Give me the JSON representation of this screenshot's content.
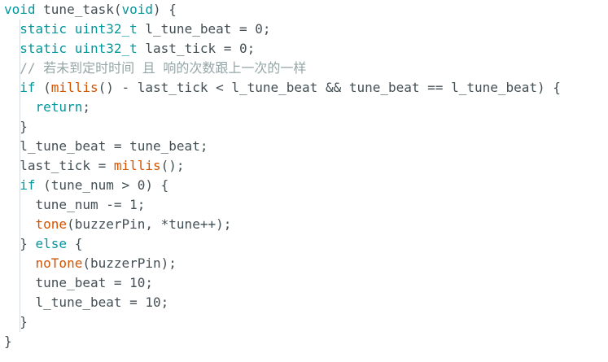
{
  "editor": {
    "lines": [
      {
        "indent": "",
        "tokens": [
          {
            "t": "void",
            "c": "kw"
          },
          {
            "t": " tune_task(",
            "c": "tx"
          },
          {
            "t": "void",
            "c": "kw"
          },
          {
            "t": ") {",
            "c": "tx"
          }
        ]
      },
      {
        "indent": "  ",
        "tokens": [
          {
            "t": "static",
            "c": "kw"
          },
          {
            "t": " ",
            "c": "tx"
          },
          {
            "t": "uint32_t",
            "c": "kw"
          },
          {
            "t": " l_tune_beat = 0;",
            "c": "tx"
          }
        ]
      },
      {
        "indent": "  ",
        "tokens": [
          {
            "t": "static",
            "c": "kw"
          },
          {
            "t": " ",
            "c": "tx"
          },
          {
            "t": "uint32_t",
            "c": "kw"
          },
          {
            "t": " last_tick = 0;",
            "c": "tx"
          }
        ]
      },
      {
        "indent": "  ",
        "tokens": [
          {
            "t": "// 若未到定时时间 且 响的次数跟上一次的一样",
            "c": "cm"
          }
        ]
      },
      {
        "indent": "  ",
        "tokens": [
          {
            "t": "if",
            "c": "kw"
          },
          {
            "t": " (",
            "c": "tx"
          },
          {
            "t": "millis",
            "c": "fn"
          },
          {
            "t": "() - last_tick < l_tune_beat && tune_beat == l_tune_beat) {",
            "c": "tx"
          }
        ]
      },
      {
        "indent": "    ",
        "tokens": [
          {
            "t": "return",
            "c": "kw"
          },
          {
            "t": ";",
            "c": "tx"
          }
        ]
      },
      {
        "indent": "  ",
        "tokens": [
          {
            "t": "}",
            "c": "tx"
          }
        ]
      },
      {
        "indent": "  ",
        "tokens": [
          {
            "t": "l_tune_beat = tune_beat;",
            "c": "tx"
          }
        ]
      },
      {
        "indent": "  ",
        "tokens": [
          {
            "t": "last_tick = ",
            "c": "tx"
          },
          {
            "t": "millis",
            "c": "fn"
          },
          {
            "t": "();",
            "c": "tx"
          }
        ]
      },
      {
        "indent": "  ",
        "tokens": [
          {
            "t": "if",
            "c": "kw"
          },
          {
            "t": " (tune_num > 0) {",
            "c": "tx"
          }
        ]
      },
      {
        "indent": "    ",
        "tokens": [
          {
            "t": "tune_num -= 1;",
            "c": "tx"
          }
        ]
      },
      {
        "indent": "    ",
        "tokens": [
          {
            "t": "tone",
            "c": "fn"
          },
          {
            "t": "(buzzerPin, *tune++);",
            "c": "tx"
          }
        ]
      },
      {
        "indent": "  ",
        "tokens": [
          {
            "t": "} ",
            "c": "tx"
          },
          {
            "t": "else",
            "c": "kw"
          },
          {
            "t": " {",
            "c": "tx"
          }
        ]
      },
      {
        "indent": "    ",
        "tokens": [
          {
            "t": "noTone",
            "c": "fn"
          },
          {
            "t": "(buzzerPin);",
            "c": "tx"
          }
        ]
      },
      {
        "indent": "    ",
        "tokens": [
          {
            "t": "tune_beat = 10;",
            "c": "tx"
          }
        ]
      },
      {
        "indent": "    ",
        "tokens": [
          {
            "t": "l_tune_beat = 10;",
            "c": "tx"
          }
        ]
      },
      {
        "indent": "  ",
        "tokens": [
          {
            "t": "}",
            "c": "tx"
          }
        ]
      },
      {
        "indent": "",
        "tokens": [
          {
            "t": "}",
            "c": "tx"
          }
        ]
      }
    ]
  },
  "colors": {
    "keyword": "#00979d",
    "function": "#d35400",
    "comment": "#95a5a6",
    "text": "#434f54",
    "indent_guide": "#d6dbe0",
    "background": "#ffffff"
  }
}
